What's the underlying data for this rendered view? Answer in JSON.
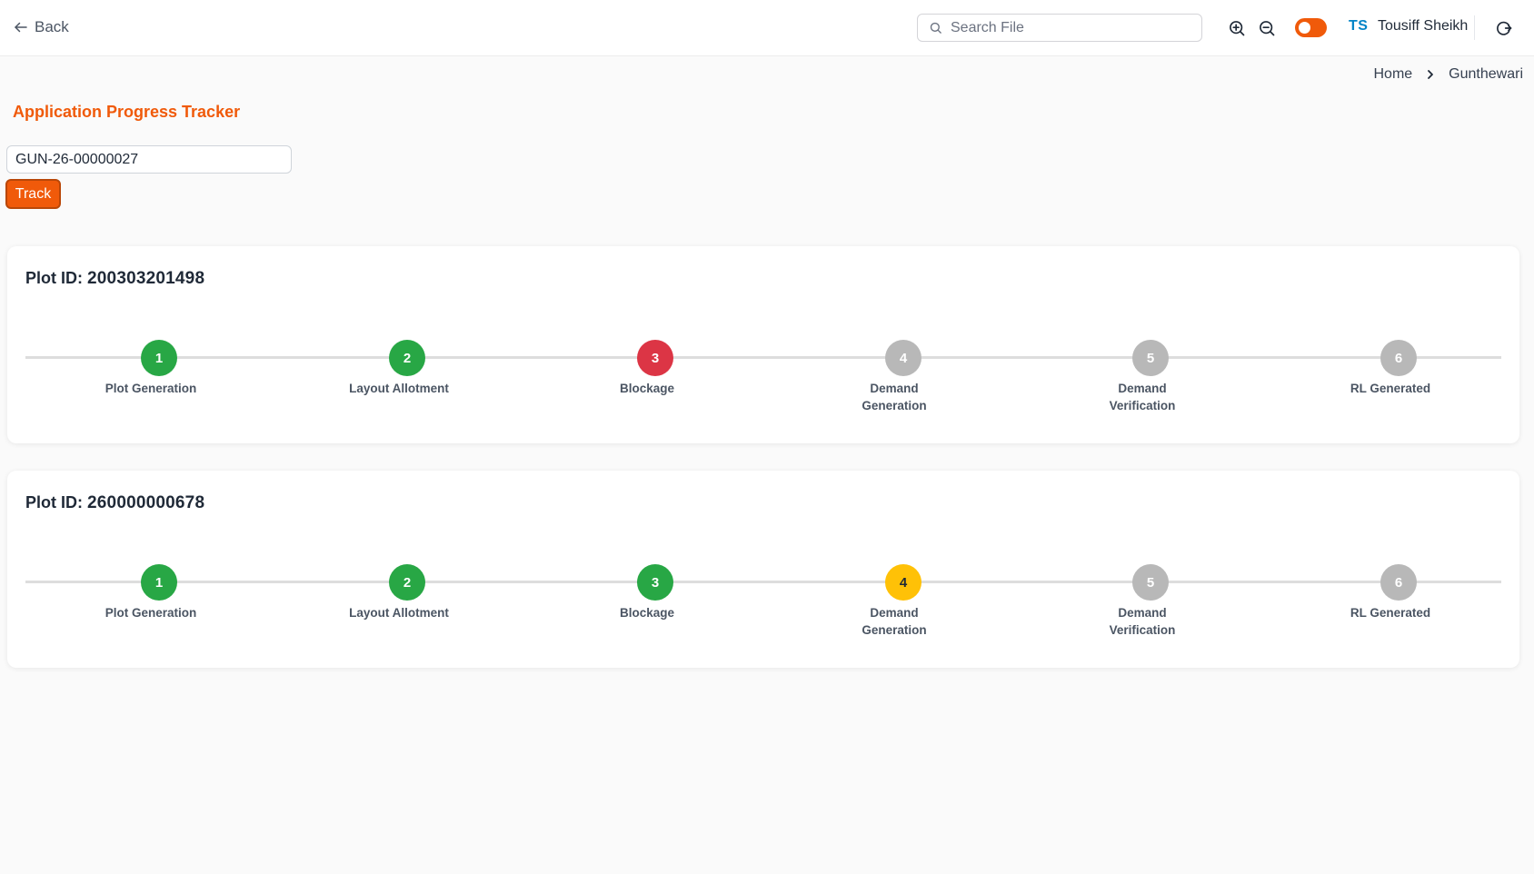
{
  "header": {
    "back_label": "Back",
    "search_placeholder": "Search File",
    "user_initials": "TS",
    "user_name": "Tousiff Sheikh",
    "icons": [
      "arrow-left-icon",
      "search-icon",
      "zoom-in-icon",
      "zoom-out-icon",
      "theme-toggle",
      "logout-icon"
    ]
  },
  "breadcrumb": {
    "items": [
      "Home",
      "Gunthewari"
    ]
  },
  "page": {
    "title": "Application Progress Tracker",
    "application_number": "GUN-26-00000027",
    "track_label": "Track"
  },
  "colors": {
    "accent": "#f05a0a",
    "complete": "#28a745",
    "blocked": "#dc3545",
    "current": "#ffc107",
    "pending": "#b8b8b8"
  },
  "plots": [
    {
      "plot_label": "Plot ID:",
      "plot_id": "200303201498",
      "steps": [
        {
          "number": "1",
          "label": "Plot Generation",
          "status": "complete"
        },
        {
          "number": "2",
          "label": "Layout Allotment",
          "status": "complete"
        },
        {
          "number": "3",
          "label": "Blockage",
          "status": "blocked"
        },
        {
          "number": "4",
          "label": "Demand Generation",
          "status": "pending"
        },
        {
          "number": "5",
          "label": "Demand Verification",
          "status": "pending"
        },
        {
          "number": "6",
          "label": "RL Generated",
          "status": "pending"
        }
      ]
    },
    {
      "plot_label": "Plot ID:",
      "plot_id": "260000000678",
      "steps": [
        {
          "number": "1",
          "label": "Plot Generation",
          "status": "complete"
        },
        {
          "number": "2",
          "label": "Layout Allotment",
          "status": "complete"
        },
        {
          "number": "3",
          "label": "Blockage",
          "status": "complete"
        },
        {
          "number": "4",
          "label": "Demand Generation",
          "status": "current"
        },
        {
          "number": "5",
          "label": "Demand Verification",
          "status": "pending"
        },
        {
          "number": "6",
          "label": "RL Generated",
          "status": "pending"
        }
      ]
    }
  ]
}
